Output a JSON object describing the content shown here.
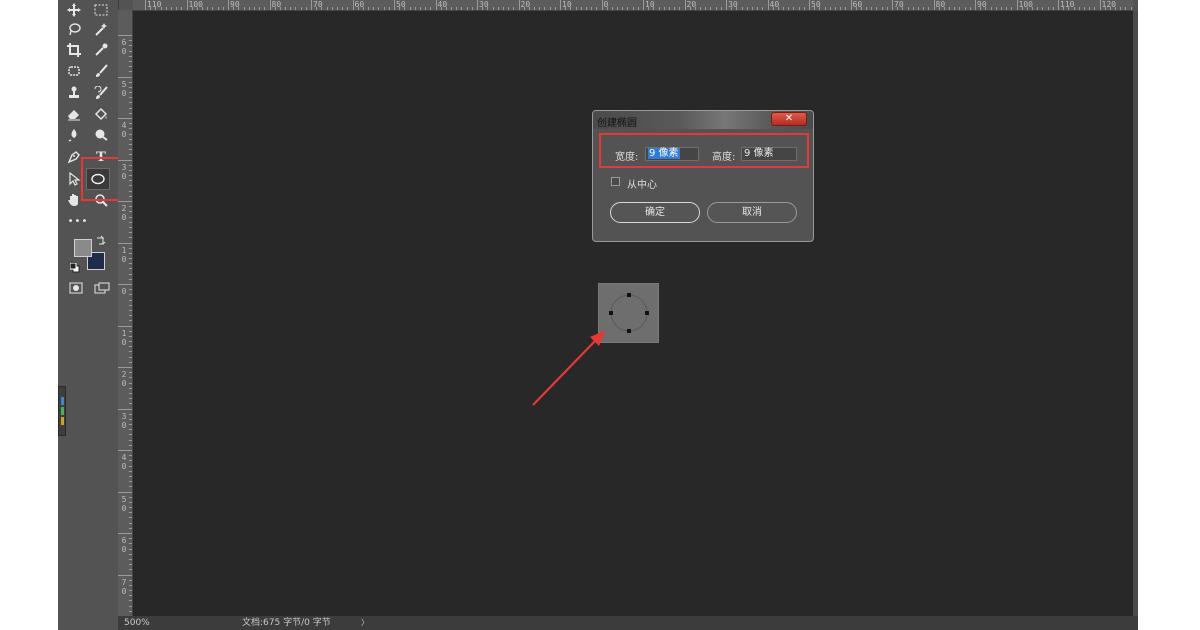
{
  "ruler_top_labels": [
    "110",
    "100",
    "90",
    "80",
    "70",
    "60",
    "50",
    "40",
    "30",
    "20",
    "10",
    "0",
    "10",
    "20",
    "30",
    "40",
    "50",
    "60",
    "70",
    "80",
    "90",
    "100",
    "110",
    "120"
  ],
  "ruler_left_labels": [
    "6\n0",
    "5\n0",
    "4\n0",
    "3\n0",
    "2\n0",
    "1\n0",
    "0",
    "1\n0",
    "2\n0",
    "3\n0",
    "4\n0",
    "5\n0",
    "6\n0",
    "7\n0"
  ],
  "toolbar": {
    "more_label": "•••",
    "text_tool_glyph": "T",
    "foreground_color": "#8a8a8a",
    "background_color": "#1f2d4a"
  },
  "dialog": {
    "title": "创建椭圆",
    "close_glyph": "✕",
    "width_label": "宽度:",
    "width_value": "9 像素",
    "height_label": "高度:",
    "height_value": "9 像素",
    "from_center_label": "从中心",
    "ok_label": "确定",
    "cancel_label": "取消"
  },
  "statusbar": {
    "zoom": "500%",
    "doc_info": "文档:675 字节/0 字节",
    "arrow": "〉"
  },
  "annotation_color": "#e53935"
}
